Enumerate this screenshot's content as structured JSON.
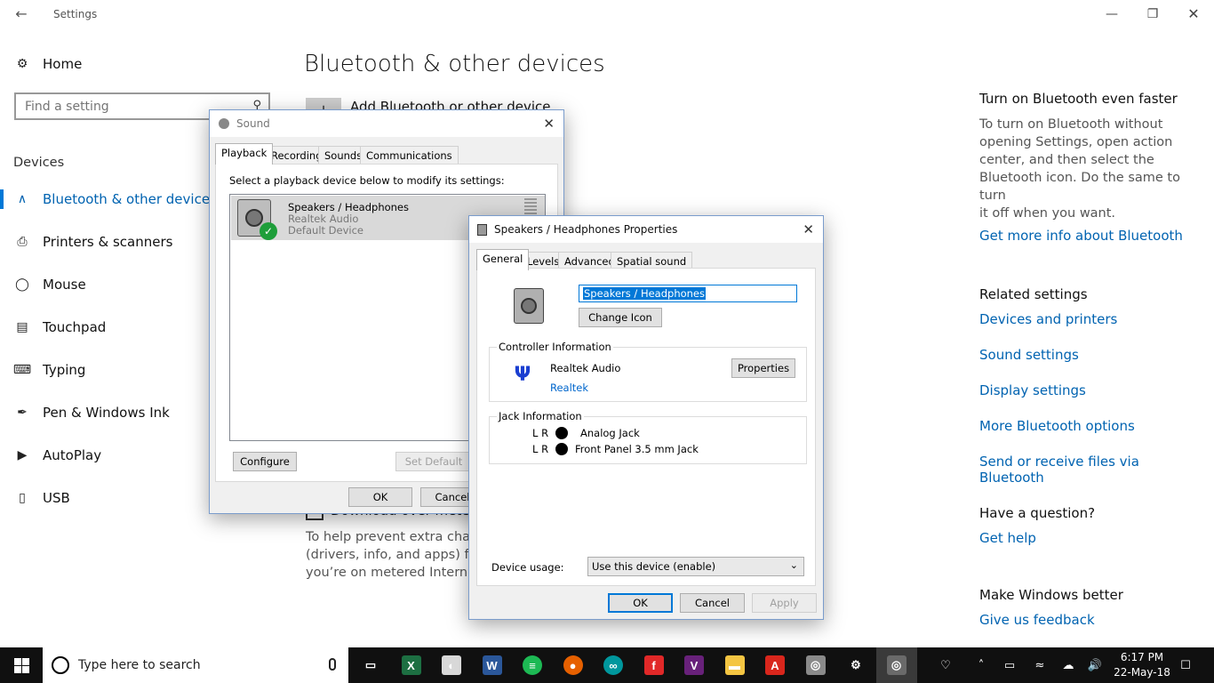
{
  "settings": {
    "window_title": "Settings",
    "home_label": "Home",
    "search_placeholder": "Find a setting",
    "section_label": "Devices",
    "nav": [
      {
        "label": "Bluetooth & other devices",
        "icon": "bluetooth-icon"
      },
      {
        "label": "Printers & scanners",
        "icon": "printer-icon"
      },
      {
        "label": "Mouse",
        "icon": "mouse-icon"
      },
      {
        "label": "Touchpad",
        "icon": "touchpad-icon"
      },
      {
        "label": "Typing",
        "icon": "keyboard-icon"
      },
      {
        "label": "Pen & Windows Ink",
        "icon": "pen-icon"
      },
      {
        "label": "AutoPlay",
        "icon": "autoplay-icon"
      },
      {
        "label": "USB",
        "icon": "usb-icon"
      }
    ],
    "page_title": "Bluetooth & other devices",
    "add_device_label": "Add Bluetooth or other device",
    "metered_checkbox_label": "Download over metered connections",
    "metered_text": [
      "To help prevent extra charges, keep this off so device software",
      "(drivers, info, and apps) for new devices won't download while",
      "you’re on metered Internet connections."
    ],
    "right": {
      "faster_heading": "Turn on Bluetooth even faster",
      "faster_text": [
        "To turn on Bluetooth without",
        "opening Settings, open action",
        "center, and then select the",
        "Bluetooth icon. Do the same to turn",
        "it off when you want."
      ],
      "faster_link": "Get more info about Bluetooth",
      "related_heading": "Related settings",
      "related_links": [
        "Devices and printers",
        "Sound settings",
        "Display settings",
        "More Bluetooth options",
        "Send or receive files via Bluetooth"
      ],
      "question_heading": "Have a question?",
      "question_link": "Get help",
      "better_heading": "Make Windows better",
      "better_link": "Give us feedback"
    }
  },
  "sound_dialog": {
    "title": "Sound",
    "tabs": [
      "Playback",
      "Recording",
      "Sounds",
      "Communications"
    ],
    "instruction": "Select a playback device below to modify its settings:",
    "device": {
      "name": "Speakers / Headphones",
      "driver": "Realtek Audio",
      "status": "Default Device"
    },
    "configure_label": "Configure",
    "set_default_label": "Set Default",
    "ok_label": "OK",
    "cancel_label": "Cancel"
  },
  "props_dialog": {
    "title": "Speakers / Headphones Properties",
    "tabs": [
      "General",
      "Levels",
      "Advanced",
      "Spatial sound"
    ],
    "name_value": "Speakers / Headphones",
    "change_icon_label": "Change Icon",
    "controller_group": "Controller Information",
    "controller_name": "Realtek Audio",
    "controller_link": "Realtek",
    "properties_label": "Properties",
    "jack_group": "Jack Information",
    "jacks": [
      {
        "channels": "L R",
        "name": "Analog Jack"
      },
      {
        "channels": "L R",
        "name": "Front Panel 3.5 mm Jack"
      }
    ],
    "usage_label": "Device usage:",
    "usage_value": "Use this device (enable)",
    "ok_label": "OK",
    "cancel_label": "Cancel",
    "apply_label": "Apply"
  },
  "taskbar": {
    "search_placeholder": "Type here to search",
    "apps": [
      {
        "name": "task-view-icon",
        "color": "#101010"
      },
      {
        "name": "excel-icon",
        "color": "#1d6f42"
      },
      {
        "name": "paint-icon",
        "color": "#d8d8d8"
      },
      {
        "name": "word-icon",
        "color": "#2b579a"
      },
      {
        "name": "spotify-icon",
        "color": "#1db954"
      },
      {
        "name": "firefox-icon",
        "color": "#e66000"
      },
      {
        "name": "arduino-icon",
        "color": "#00979d"
      },
      {
        "name": "flipboard-icon",
        "color": "#e12828"
      },
      {
        "name": "visual-studio-icon",
        "color": "#68217a"
      },
      {
        "name": "file-explorer-icon",
        "color": "#f4c542"
      },
      {
        "name": "acrobat-icon",
        "color": "#d9261c"
      },
      {
        "name": "audio-icon",
        "color": "#8a8a8a"
      },
      {
        "name": "settings-icon",
        "color": "#101010"
      },
      {
        "name": "sound-icon",
        "color": "#6a6a6a"
      }
    ],
    "time": "6:17 PM",
    "date": "22-May-18"
  }
}
